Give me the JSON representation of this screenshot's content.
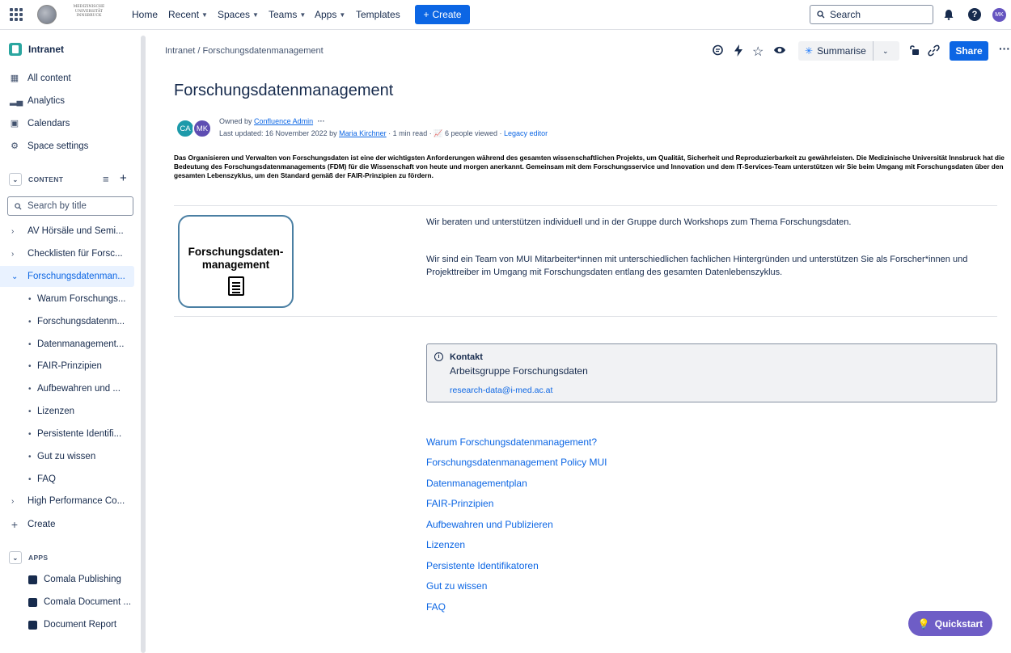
{
  "topnav": {
    "logo_text": "MEDIZINISCHE UNIVERSITÄT INNSBRUCK",
    "items": [
      "Home",
      "Recent",
      "Spaces",
      "Teams",
      "Apps",
      "Templates"
    ],
    "create_label": "Create",
    "search_placeholder": "Search",
    "user_initials": "MK"
  },
  "sidebar": {
    "space_name": "Intranet",
    "links": [
      "All content",
      "Analytics",
      "Calendars",
      "Space settings"
    ],
    "content_header": "CONTENT",
    "search_placeholder": "Search by title",
    "tree": [
      {
        "label": "AV Hörsäle und Semi...",
        "level": 0,
        "state": "collapsed"
      },
      {
        "label": "Checklisten für Forsc...",
        "level": 0,
        "state": "collapsed"
      },
      {
        "label": "Forschungsdatenman...",
        "level": 0,
        "state": "expanded-active"
      },
      {
        "label": "Warum Forschungs...",
        "level": 1
      },
      {
        "label": "Forschungsdatenm...",
        "level": 1
      },
      {
        "label": "Datenmanagement...",
        "level": 1
      },
      {
        "label": "FAIR-Prinzipien",
        "level": 1
      },
      {
        "label": "Aufbewahren und ...",
        "level": 1
      },
      {
        "label": "Lizenzen",
        "level": 1
      },
      {
        "label": "Persistente Identifi...",
        "level": 1
      },
      {
        "label": "Gut zu wissen",
        "level": 1
      },
      {
        "label": "FAQ",
        "level": 1
      },
      {
        "label": "High Performance Co...",
        "level": 0,
        "state": "collapsed"
      }
    ],
    "create_label": "Create",
    "apps_header": "APPS",
    "apps": [
      "Comala Publishing",
      "Comala Document ...",
      "Document Report"
    ]
  },
  "page": {
    "breadcrumb": "Intranet  /  Forschungsdatenmanagement",
    "summarise_label": "Summarise",
    "share_label": "Share",
    "title": "Forschungsdatenmanagement",
    "owner_prefix": "Owned by",
    "owner_name": "Confluence Admin",
    "owner_more": "···",
    "updated_prefix": "Last updated: 16 November 2022 by",
    "updated_by": "Maria Kirchner",
    "read_time": "1 min read",
    "views": "6 people viewed",
    "legacy": "Legacy editor",
    "avatars": [
      {
        "initials": "CA",
        "color": "#1d9aaa"
      },
      {
        "initials": "MK",
        "color": "#5e4db2"
      }
    ],
    "intro": "Das Organisieren und Verwalten von Forschungsdaten ist eine der wichtigsten Anforderungen während des gesamten wissenschaftlichen Projekts, um Qualität, Sicherheit und Reproduzierbarkeit zu gewährleisten. Die Medizinische Universität Innsbruck hat die Bedeutung des Forschungsdatenmanagements (FDM) für die Wissenschaft von heute und morgen anerkannt. Gemeinsam mit dem Forschungsservice und Innovation und dem IT-Services-Team unterstützen wir Sie beim Umgang mit Forschungsdaten über den gesamten Lebenszyklus, um den Standard gemäß der FAIR-Prinzipien zu fördern.",
    "image_line1": "Forschungsdaten-",
    "image_line2": "management",
    "para1": "Wir beraten und unterstützen individuell und in der Gruppe durch Workshops zum Thema Forschungsdaten.",
    "para2": "Wir sind ein Team von MUI Mitarbeiter*innen mit unterschiedlichen fachlichen Hintergründen und unterstützen Sie als Forscher*innen und Projekttreiber im Umgang mit Forschungsdaten entlang des gesamten Datenlebenszyklus.",
    "panel_title": "Kontakt",
    "panel_sub": "Arbeitsgruppe Forschungsdaten",
    "panel_mail": "research-data@i-med.ac.at",
    "links": [
      "Warum Forschungsdatenmanagement?",
      "Forschungsdatenmanagement Policy MUI",
      "Datenmanagementplan",
      "FAIR-Prinzipien",
      "Aufbewahren und Publizieren",
      "Lizenzen",
      "Persistente Identifikatoren",
      "Gut zu wissen",
      "FAQ"
    ],
    "quickstart_label": "Quickstart"
  }
}
